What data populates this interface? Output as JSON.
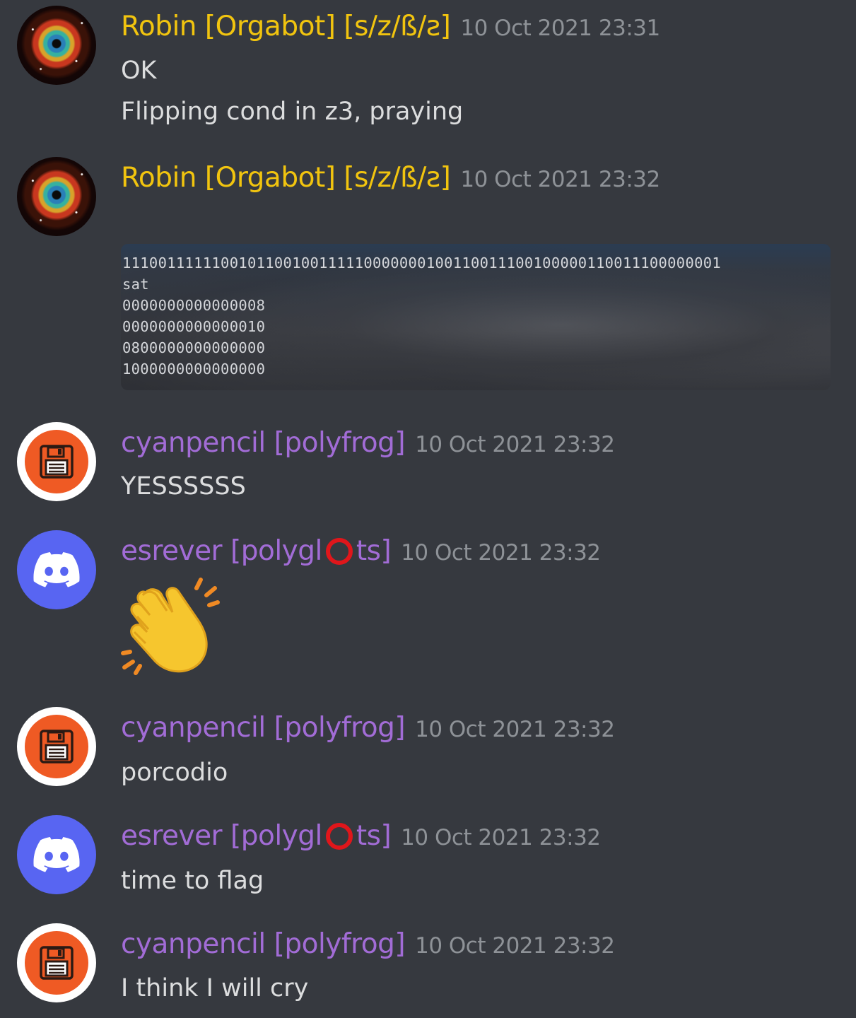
{
  "messages": [
    {
      "author": "Robin [Orgabot] [s/z/ß/ƨ]",
      "timestamp": "10 Oct 2021 23:31",
      "lines": [
        "OK",
        "Flipping cond in z3, praying"
      ]
    },
    {
      "author": "Robin [Orgabot] [s/z/ß/ƨ]",
      "timestamp": "10 Oct 2021 23:32",
      "code": "1110011111100101100100111110000000100110011100100000110011100000001\nsat\n0000000000000008\n0000000000000010\n0800000000000000\n1000000000000000"
    },
    {
      "author": "cyanpencil [polyfrog]",
      "timestamp": "10 Oct 2021 23:32",
      "lines": [
        "YESSSSSS"
      ]
    },
    {
      "author_prefix": "esrever [polygl",
      "author_suffix": "ts]",
      "timestamp": "10 Oct 2021 23:32",
      "emoji": "clapping-hands"
    },
    {
      "author": "cyanpencil [polyfrog]",
      "timestamp": "10 Oct 2021 23:32",
      "lines": [
        "porcodio"
      ]
    },
    {
      "author_prefix": "esrever [polygl",
      "author_suffix": "ts]",
      "timestamp": "10 Oct 2021 23:32",
      "lines": [
        "time to flag"
      ]
    },
    {
      "author": "cyanpencil [polyfrog]",
      "timestamp": "10 Oct 2021 23:32",
      "lines": [
        "I think I will cry"
      ]
    }
  ],
  "colors": {
    "background": "#36393f",
    "robin_name": "#f1c40f",
    "purple_name": "#a26cd6",
    "timestamp": "#8e9297",
    "text": "#dcddde",
    "discord_blurple": "#5865f2",
    "floppy_orange": "#ef5a24"
  },
  "icons": [
    "nebula-avatar",
    "floppy-disk-icon",
    "discord-logo-icon",
    "red-circle-icon",
    "clapping-hands-emoji"
  ]
}
